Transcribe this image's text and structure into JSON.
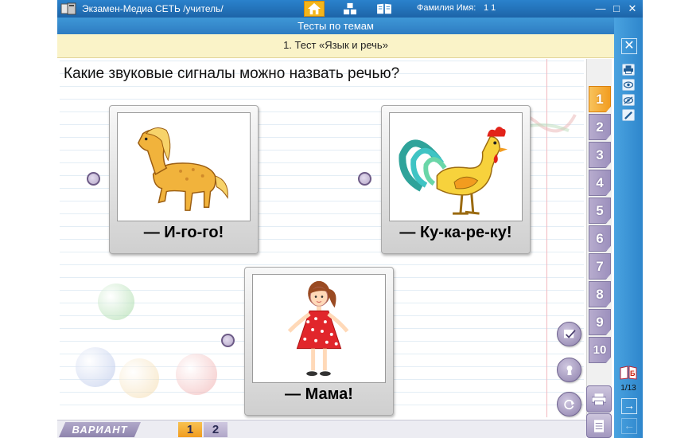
{
  "window": {
    "title": "Экзамен-Медиа СЕТЬ /учитель/",
    "user_label": "Фамилия Имя:",
    "user_value": "1 1",
    "minimize": "—",
    "maximize": "□",
    "close": "✕"
  },
  "nav": {
    "icons": [
      "home-icon",
      "cubes-icon",
      "book-icon"
    ]
  },
  "header": {
    "section_title": "Тесты по темам",
    "topic_title": "1. Тест «Язык и речь»"
  },
  "question": {
    "text": "Какие звуковые сигналы можно назвать речью?"
  },
  "answers": [
    {
      "label": "— И-го-го!",
      "image": "horse"
    },
    {
      "label": "— Ку-ка-ре-ку!",
      "image": "rooster"
    },
    {
      "label": "— Мама!",
      "image": "girl"
    }
  ],
  "question_tabs": [
    "1",
    "2",
    "3",
    "4",
    "5",
    "6",
    "7",
    "8",
    "9",
    "10"
  ],
  "active_tab": "1",
  "sidebar": {
    "close": "✕",
    "page_counter": "1/13",
    "next_arrow": "→",
    "prev_arrow": "←"
  },
  "footer": {
    "variant_label": "ВАРИАНТ",
    "variants": [
      "1",
      "2"
    ],
    "active_variant": "1"
  },
  "colors": {
    "title_bar": "#1d64a8",
    "accent_orange": "#f29c1f",
    "tab_purple": "#9c90bd",
    "topic_bg": "#faf3c8"
  }
}
